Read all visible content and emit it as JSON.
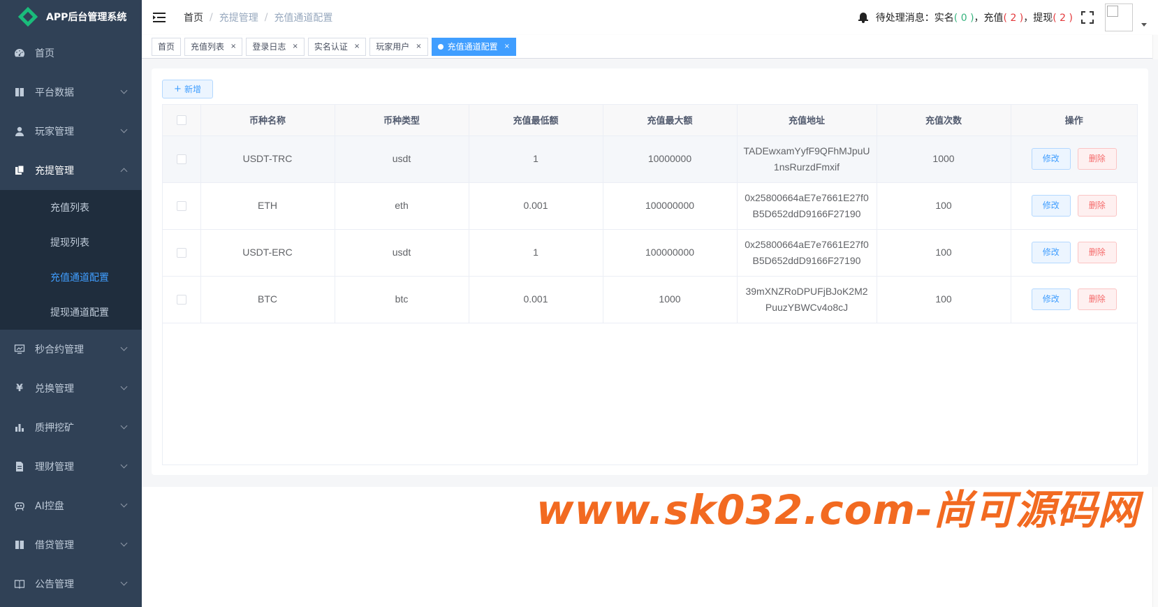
{
  "app": {
    "title": "APP后台管理系统"
  },
  "sidebar": {
    "items": [
      {
        "label": "首页",
        "icon": "dashboard-icon"
      },
      {
        "label": "平台数据",
        "icon": "book-icon"
      },
      {
        "label": "玩家管理",
        "icon": "user-icon"
      },
      {
        "label": "充提管理",
        "icon": "clipboard-icon"
      },
      {
        "label": "秒合约管理",
        "icon": "monitor-icon"
      },
      {
        "label": "兑换管理",
        "icon": "yen-icon"
      },
      {
        "label": "质押挖矿",
        "icon": "bar-chart-icon"
      },
      {
        "label": "理财管理",
        "icon": "document-icon"
      },
      {
        "label": "AI控盘",
        "icon": "robot-icon"
      },
      {
        "label": "借贷管理",
        "icon": "book-icon"
      },
      {
        "label": "公告管理",
        "icon": "notice-book-icon"
      }
    ],
    "submenu": [
      {
        "label": "充值列表"
      },
      {
        "label": "提现列表"
      },
      {
        "label": "充值通道配置"
      },
      {
        "label": "提现通道配置"
      }
    ]
  },
  "header": {
    "breadcrumb": [
      "首页",
      "充提管理",
      "充值通道配置"
    ],
    "breadcrumb_sep": "/",
    "notice_label": "待处理消息：实名",
    "notice_realname": "( 0 )",
    "notice_recharge_label": "，充值",
    "notice_recharge": "( 2 )",
    "notice_withdraw_label": "，提现",
    "notice_withdraw": "( 2 )"
  },
  "tags": [
    {
      "label": "首页"
    },
    {
      "label": "充值列表"
    },
    {
      "label": "登录日志"
    },
    {
      "label": "实名认证"
    },
    {
      "label": "玩家用户"
    },
    {
      "label": "充值通道配置"
    }
  ],
  "tag_close": "×",
  "toolbar": {
    "add_label": "新增",
    "add_plus": "+"
  },
  "table": {
    "columns": [
      "币种名称",
      "币种类型",
      "充值最低额",
      "充值最大额",
      "充值地址",
      "充值次数",
      "操作"
    ],
    "edit_label": "修改",
    "delete_label": "删除",
    "rows": [
      {
        "name": "USDT-TRC",
        "type": "usdt",
        "min": "1",
        "max": "10000000",
        "address": "TADEwxamYyfF9QFhMJpuU1nsRurzdFmxif",
        "count": "1000"
      },
      {
        "name": "ETH",
        "type": "eth",
        "min": "0.001",
        "max": "100000000",
        "address": "0x25800664aE7e7661E27f0B5D652ddD9166F27190",
        "count": "100"
      },
      {
        "name": "USDT-ERC",
        "type": "usdt",
        "min": "1",
        "max": "100000000",
        "address": "0x25800664aE7e7661E27f0B5D652ddD9166F27190",
        "count": "100"
      },
      {
        "name": "BTC",
        "type": "btc",
        "min": "0.001",
        "max": "1000",
        "address": "39mXNZRoDPUFjBJoK2M2PuuzYBWCv4o8cJ",
        "count": "100"
      }
    ]
  },
  "watermark": "www.sk032.com-尚可源码网",
  "colors": {
    "sidebar_bg": "#304156",
    "accent": "#409eff",
    "danger": "#f56c6c",
    "watermark": "#f26a21"
  }
}
